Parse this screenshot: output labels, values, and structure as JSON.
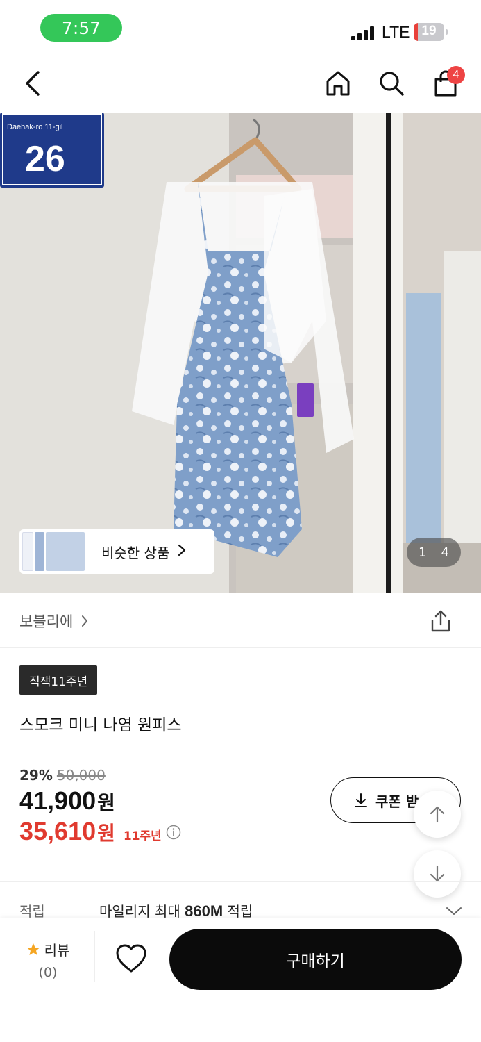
{
  "status_bar": {
    "time": "7:57",
    "network": "LTE",
    "battery": "19"
  },
  "nav": {
    "cart_count": "4",
    "icons": [
      "back-icon",
      "home-icon",
      "search-icon",
      "shopping-bag-icon"
    ]
  },
  "gallery": {
    "similar_label": "비슷한 상품",
    "current": "1",
    "total": "4",
    "sign_number": "26",
    "sign_text": "Daehak-ro 11-gil"
  },
  "product": {
    "brand": "보블리에",
    "tag": "직잭11주년",
    "title": "스모크 미니 나염 원피스",
    "discount_pct": "29%",
    "original_price": "50,000",
    "price": "41,900",
    "price_unit": "원",
    "sale_price": "35,610",
    "sale_unit": "원",
    "sale_note": "11주년"
  },
  "coupon": {
    "label": "쿠폰 받"
  },
  "points": {
    "label": "적립",
    "value_prefix": "마일리지 최대 ",
    "value_bold": "860M",
    "value_suffix": " 적립"
  },
  "bottom_bar": {
    "review_label": "리뷰",
    "review_count": "(0)",
    "buy_label": "구매하기"
  },
  "colors": {
    "sale_red": "#e03a2f",
    "status_green": "#34c759",
    "badge_red": "#ee4444",
    "button_black": "#0b0b0b"
  }
}
